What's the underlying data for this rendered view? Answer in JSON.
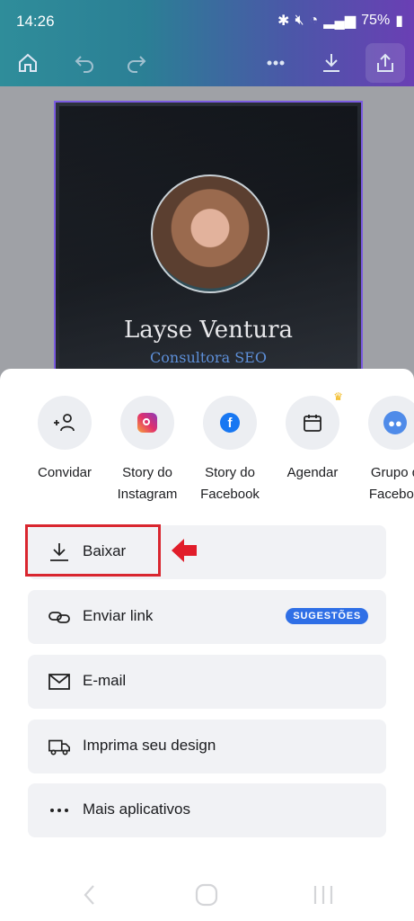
{
  "status_bar": {
    "time": "14:26",
    "battery": "75%"
  },
  "design": {
    "name": "Layse Ventura",
    "subtitle": "Consultora SEO"
  },
  "share_apps": [
    {
      "label": "Convidar",
      "icon": "add-people-icon"
    },
    {
      "label": "Story do\nInstagram",
      "icon": "instagram-icon"
    },
    {
      "label": "Story do\nFacebook",
      "icon": "facebook-icon"
    },
    {
      "label": "Agendar",
      "icon": "calendar-icon",
      "premium": true
    },
    {
      "label": "Grupo d\nFaceboo",
      "icon": "facebook-group-icon"
    }
  ],
  "options": [
    {
      "label": "Baixar",
      "icon": "download-icon"
    },
    {
      "label": "Enviar link",
      "icon": "link-icon",
      "badge": "SUGESTÕES"
    },
    {
      "label": "E-mail",
      "icon": "mail-icon"
    },
    {
      "label": "Imprima seu design",
      "icon": "truck-icon"
    },
    {
      "label": "Mais aplicativos",
      "icon": "more-icon"
    }
  ],
  "colors": {
    "accent": "#2f6fe6",
    "highlight": "#d9262f"
  }
}
